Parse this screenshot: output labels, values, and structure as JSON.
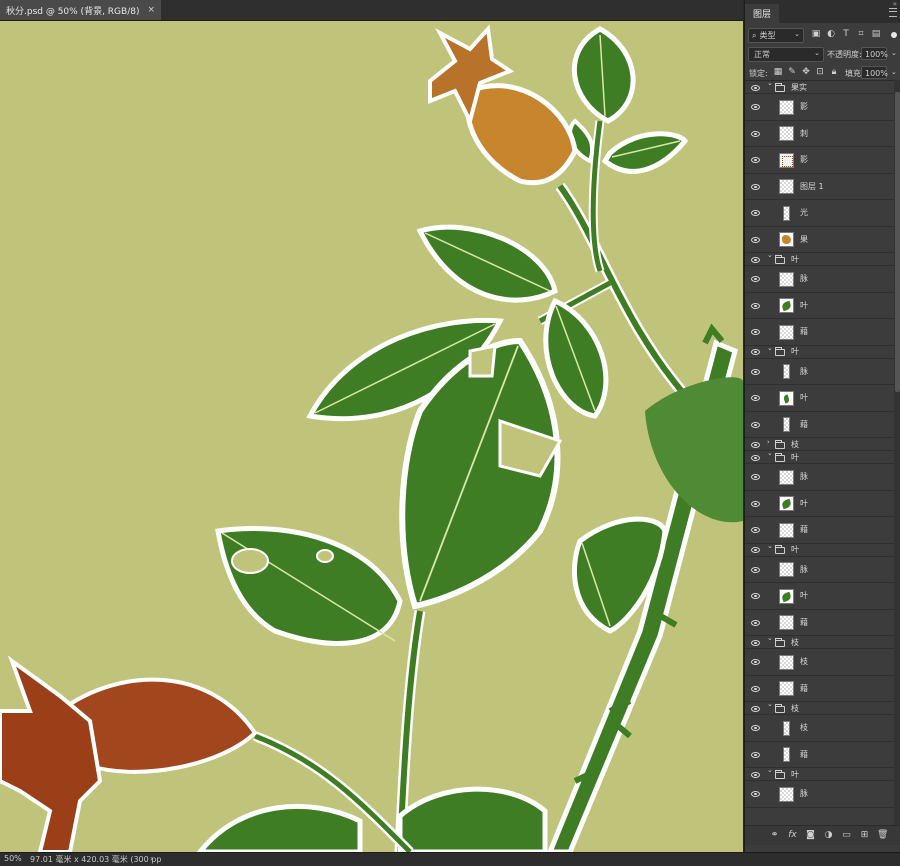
{
  "document_tab": {
    "title": "秋分.psd @ 50% (背景, RGB/8)",
    "close": "×"
  },
  "status": {
    "zoom": "50%",
    "info": "97.01 毫米 x 420.03 毫米 (300 pp",
    "arrow": "›"
  },
  "panel": {
    "tab": "图层",
    "collapse": "»",
    "filter": {
      "kind_label": "类型",
      "icons": [
        "image-filter-icon",
        "adjustment-filter-icon",
        "type-filter-icon",
        "shape-filter-icon",
        "smart-object-filter-icon"
      ]
    },
    "blend": {
      "mode": "正常",
      "opacity_label": "不透明度:",
      "opacity_value": "100%"
    },
    "lock": {
      "label": "锁定:",
      "fill_label": "填充:",
      "fill_value": "100%"
    },
    "layers": [
      {
        "type": "group",
        "name": "果实",
        "expanded": true
      },
      {
        "type": "layer",
        "name": "影",
        "thumb": "checker"
      },
      {
        "type": "layer",
        "name": "刺",
        "thumb": "checker"
      },
      {
        "type": "layer",
        "name": "影",
        "thumb": "fruit-shadow"
      },
      {
        "type": "layer",
        "name": "图层 1",
        "thumb": "checker"
      },
      {
        "type": "layer",
        "name": "光",
        "thumb": "narrow"
      },
      {
        "type": "layer",
        "name": "果",
        "thumb": "fruit"
      },
      {
        "type": "group",
        "name": "叶",
        "expanded": true
      },
      {
        "type": "layer",
        "name": "脉",
        "thumb": "checker"
      },
      {
        "type": "layer",
        "name": "叶",
        "thumb": "leaf"
      },
      {
        "type": "layer",
        "name": "藉",
        "thumb": "checker"
      },
      {
        "type": "group",
        "name": "叶",
        "expanded": true
      },
      {
        "type": "layer",
        "name": "脉",
        "thumb": "narrow"
      },
      {
        "type": "layer",
        "name": "叶",
        "thumb": "leaf-small"
      },
      {
        "type": "layer",
        "name": "藉",
        "thumb": "narrow"
      },
      {
        "type": "group",
        "name": "枝",
        "expanded": false
      },
      {
        "type": "group",
        "name": "叶",
        "expanded": true
      },
      {
        "type": "layer",
        "name": "脉",
        "thumb": "checker"
      },
      {
        "type": "layer",
        "name": "叶",
        "thumb": "leaf"
      },
      {
        "type": "layer",
        "name": "藉",
        "thumb": "checker"
      },
      {
        "type": "group",
        "name": "叶",
        "expanded": true
      },
      {
        "type": "layer",
        "name": "脉",
        "thumb": "checker"
      },
      {
        "type": "layer",
        "name": "叶",
        "thumb": "leaf-sprig"
      },
      {
        "type": "layer",
        "name": "藉",
        "thumb": "checker"
      },
      {
        "type": "group",
        "name": "枝",
        "expanded": true
      },
      {
        "type": "layer",
        "name": "枝",
        "thumb": "checker"
      },
      {
        "type": "layer",
        "name": "藉",
        "thumb": "checker"
      },
      {
        "type": "group",
        "name": "枝",
        "expanded": true
      },
      {
        "type": "layer",
        "name": "枝",
        "thumb": "narrow"
      },
      {
        "type": "layer",
        "name": "藉",
        "thumb": "narrow"
      },
      {
        "type": "group",
        "name": "叶",
        "expanded": true
      },
      {
        "type": "layer",
        "name": "脉",
        "thumb": "checker"
      }
    ],
    "bottom_icons": [
      "link-layers-icon",
      "fx-icon",
      "mask-icon",
      "adjustment-layer-icon",
      "new-group-icon",
      "new-layer-icon",
      "trash-icon"
    ],
    "bottom_fx": "fx"
  },
  "colors": {
    "canvas": "#c0c47a",
    "leaf": "#3f7d25",
    "leaf_light": "#4c8a2e",
    "fruit_orange": "#c7852e",
    "fruit_red": "#a2471d"
  }
}
